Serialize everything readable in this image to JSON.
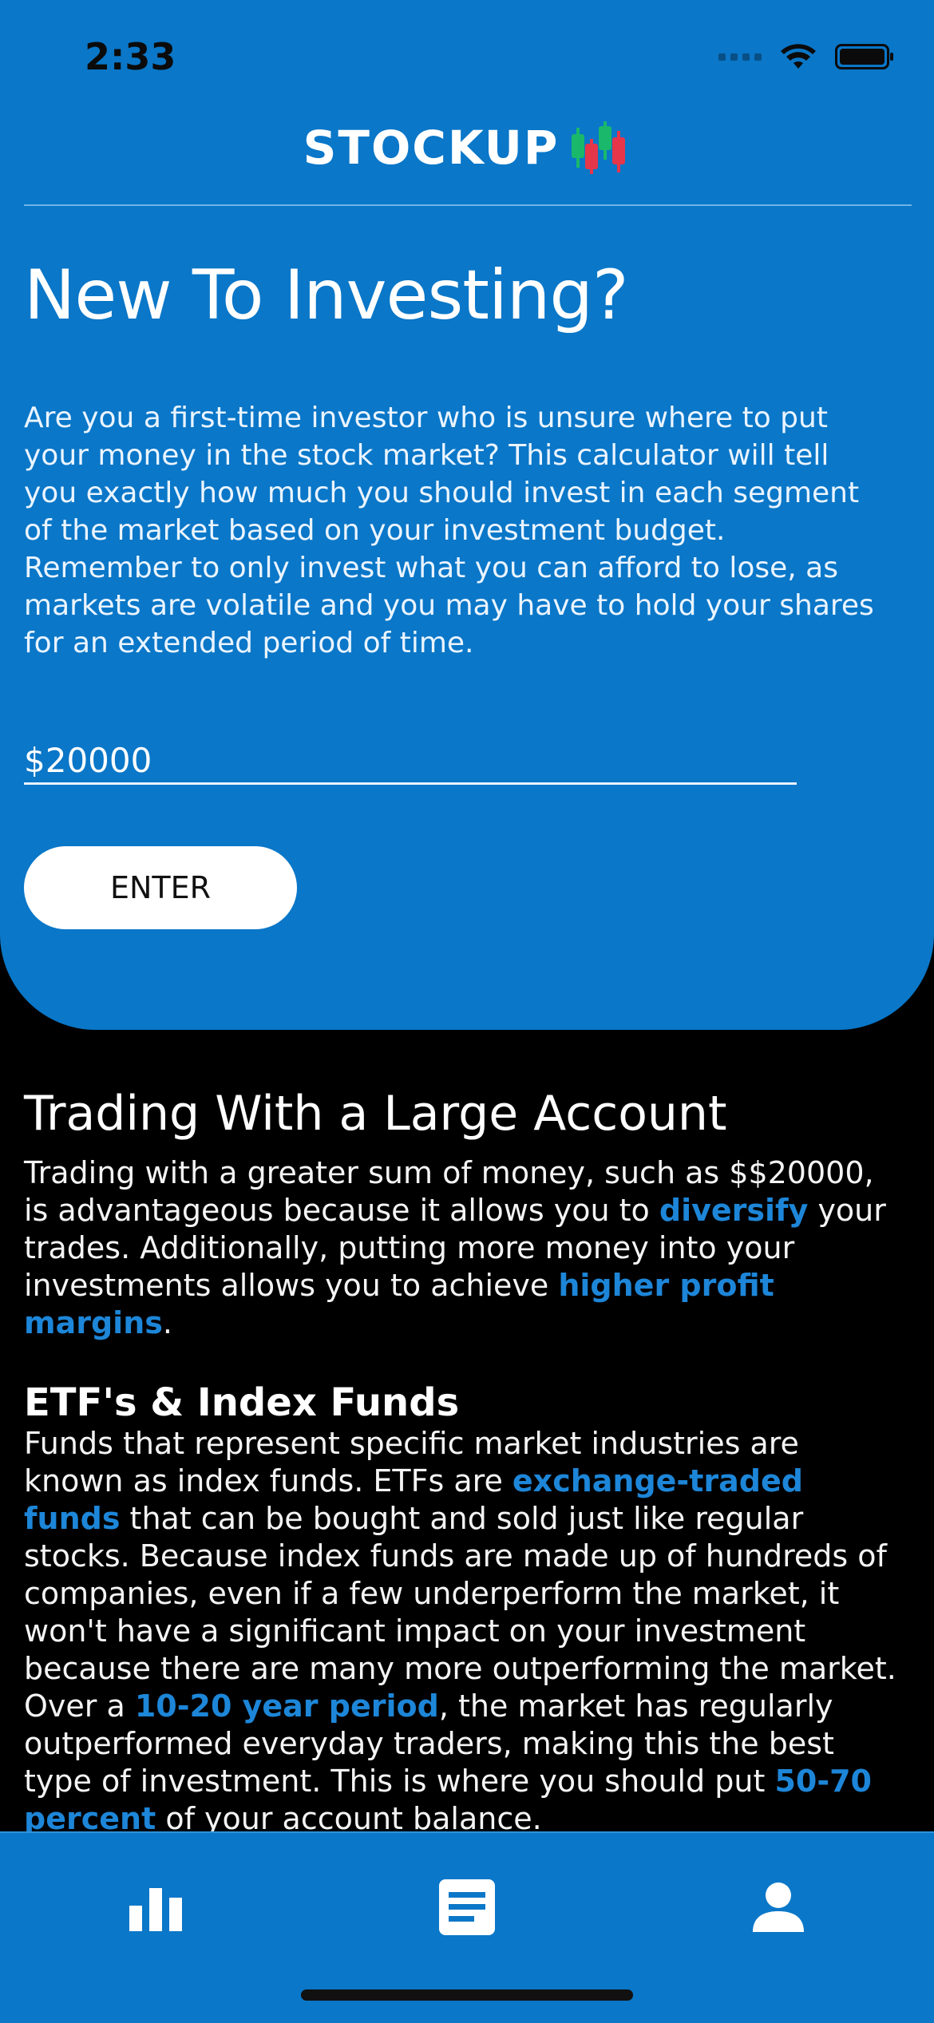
{
  "status_bar": {
    "time": "2:33",
    "signal_icon": "signal-dots-icon",
    "wifi_icon": "wifi-icon",
    "battery_icon": "battery-icon"
  },
  "brand": {
    "name": "STOCKUP",
    "logo_icon": "candlestick-chart-icon"
  },
  "hero": {
    "title": "New To Investing?",
    "intro": "Are you a first-time investor who is unsure where to put your money in the stock market? This calculator will tell you exactly how much you should invest in each segment of the market based on your investment budget. Remember to only invest what you can afford to lose, as markets are volatile and you may have to hold your shares for an extended period of time.",
    "amount_value": "$20000",
    "enter_label": "ENTER"
  },
  "content": {
    "large_account_title": "Trading With a Large Account",
    "large_account_parts": [
      "Trading with a greater sum of money, such as $$20000, is advantageous because it allows you to ",
      "diversify",
      " your trades. Additionally, putting more money into your investments allows you to achieve ",
      "higher profit margins",
      "."
    ],
    "etf_title": "ETF's & Index Funds",
    "etf_parts": [
      "Funds that represent specific market industries are known as index funds. ETFs are ",
      "exchange-traded funds",
      " that can be bought and sold just like regular stocks. Because index funds are made up of hundreds of companies, even if a few underperform the market, it won't have a significant impact on your investment because there are many more outperforming the market. Over a ",
      "10-20 year period",
      ", the market has regularly outperformed everyday traders, making this the best type of investment. This is where you should put ",
      "50-70 percent",
      " of your account balance."
    ]
  },
  "tabbar": {
    "tabs": [
      {
        "icon": "bar-chart-icon",
        "name": "tab-charts"
      },
      {
        "icon": "document-icon",
        "name": "tab-articles"
      },
      {
        "icon": "user-icon",
        "name": "tab-profile"
      }
    ]
  },
  "colors": {
    "primary": "#0a77c8",
    "highlight": "#1d86d8",
    "candle_green": "#19b86b",
    "candle_red": "#e5364a"
  }
}
